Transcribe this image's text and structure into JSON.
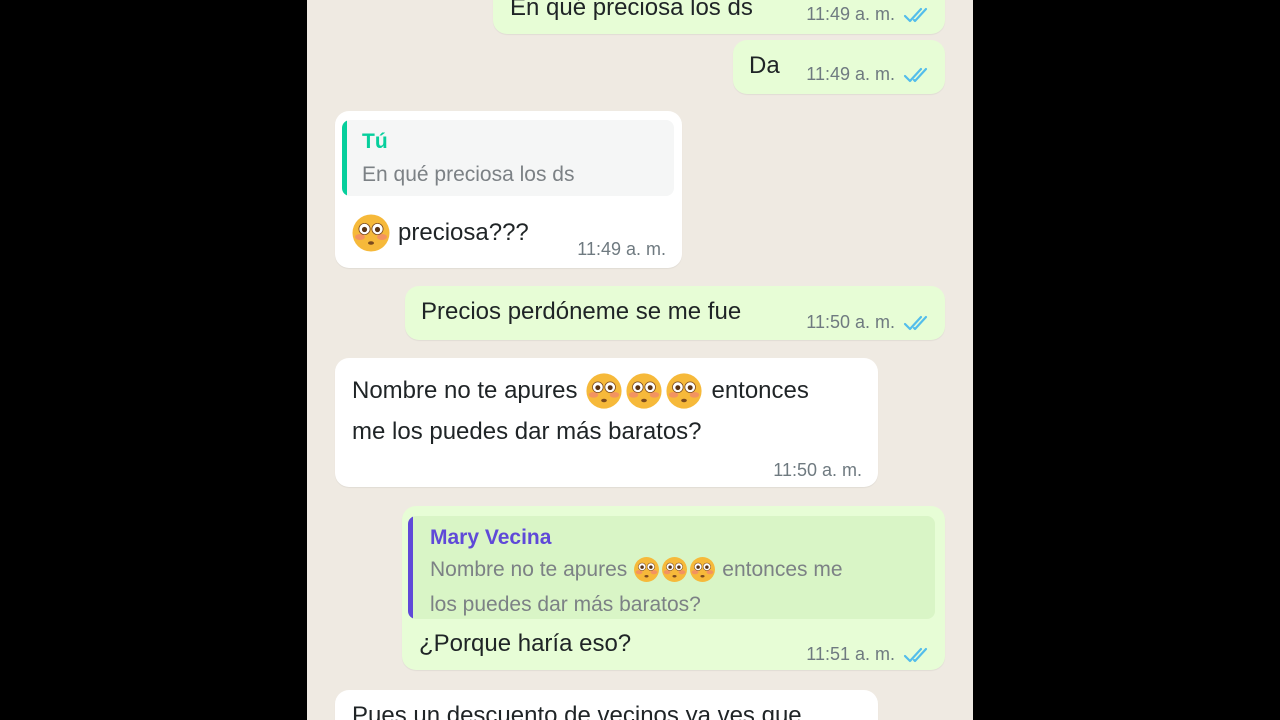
{
  "colors": {
    "outgoing_bubble": "#e7fdd6",
    "incoming_bubble": "#ffffff",
    "read_ticks": "#53bdeb",
    "quote_self": "#06cf9c",
    "quote_contact": "#5f49d8",
    "chat_background": "#efeae2"
  },
  "messages": [
    {
      "direction": "out",
      "text": "En qué preciosa los ds",
      "time": "11:49 a. m.",
      "status": "read-double-check-icon"
    },
    {
      "direction": "out",
      "text": "Da",
      "time": "11:49 a. m.",
      "status": "read-double-check-icon"
    },
    {
      "direction": "in",
      "reply_to": {
        "author": "Tú",
        "text": "En qué preciosa los ds"
      },
      "emoji": "flushed-face",
      "text": "preciosa???",
      "time": "11:49 a. m."
    },
    {
      "direction": "out",
      "text": "Precios perdóneme se me fue",
      "time": "11:50 a. m.",
      "status": "read-double-check-icon"
    },
    {
      "direction": "in",
      "text_before_emoji": "Nombre no te apures",
      "emoji": [
        "flushed-face",
        "flushed-face",
        "flushed-face"
      ],
      "text_after_emoji": "entonces",
      "text_line2": "me los puedes dar más baratos?",
      "time": "11:50 a. m."
    },
    {
      "direction": "out",
      "reply_to": {
        "author": "Mary Vecina",
        "text_before_emoji": "Nombre no te apures",
        "emoji": [
          "flushed-face",
          "flushed-face",
          "flushed-face"
        ],
        "text_after_emoji": "entonces me",
        "text_line2": "los puedes dar más baratos?"
      },
      "text": "¿Porque haría eso?",
      "time": "11:51 a. m.",
      "status": "read-double-check-icon"
    },
    {
      "direction": "in",
      "text": "Pues un descuento de vecinos ya ves que"
    }
  ]
}
